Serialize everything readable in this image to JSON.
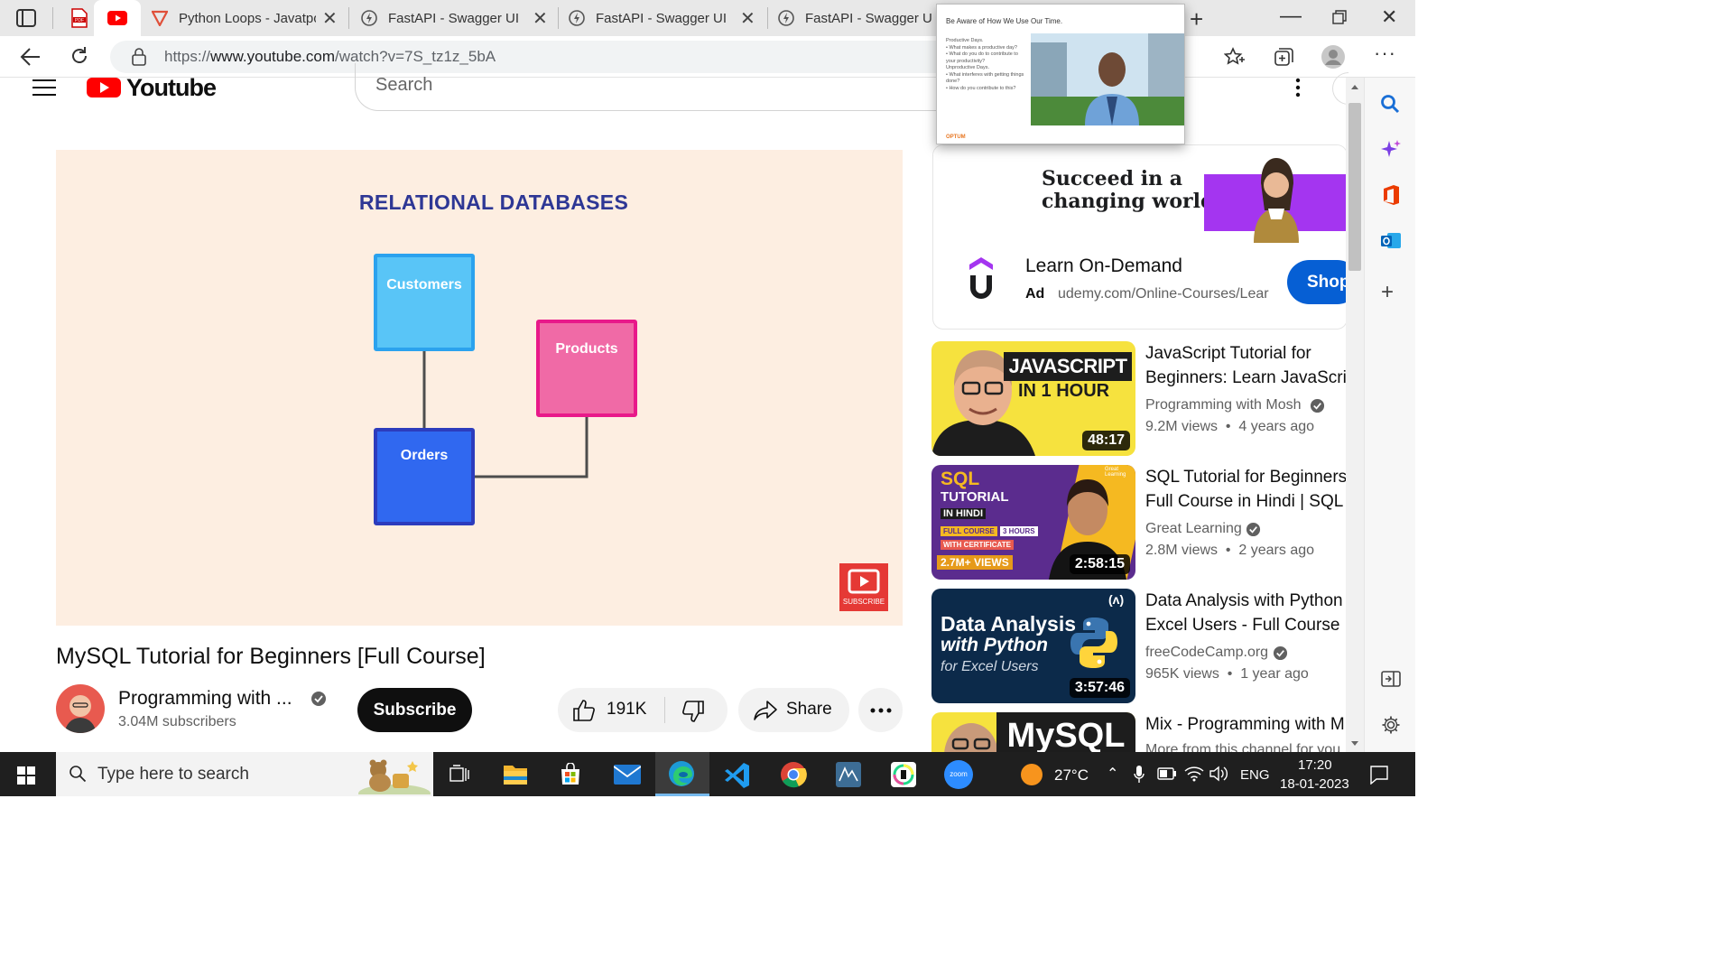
{
  "browser": {
    "tabs": [
      {
        "label": "",
        "icon": "pdf-icon"
      },
      {
        "label": "",
        "icon": "youtube-icon"
      },
      {
        "label": "Python Loops - Javatpo",
        "icon": "javatpoint-icon"
      },
      {
        "label": "FastAPI - Swagger UI",
        "icon": "fastapi-icon"
      },
      {
        "label": "FastAPI - Swagger UI",
        "icon": "fastapi-icon"
      },
      {
        "label": "FastAPI - Swagger UI",
        "icon": "fastapi-icon"
      }
    ],
    "url_prefix": "https://",
    "url_host": "www.youtube.com",
    "url_path": "/watch?v=7S_tz1z_5bA"
  },
  "tab_preview": {
    "heading": "Be Aware of How We Use Our Time.",
    "lines": [
      "Productive Days.",
      "• What makes a productive day?",
      "• What do you do to contribute to your productivity?",
      "Unproductive Days.",
      "• What interferes with getting things done?",
      "• How do you contribute to this?"
    ],
    "footer_logo": "OPTUM"
  },
  "youtube": {
    "logo_text": "Youtube",
    "search_placeholder": "Search"
  },
  "video": {
    "frame_heading": "RELATIONAL DATABASES",
    "boxes": {
      "customers": "Customers",
      "products": "Products",
      "orders": "Orders"
    },
    "subscribe_badge": "SUBSCRIBE",
    "title": "MySQL Tutorial for Beginners [Full Course]",
    "channel_name": "Programming with ...",
    "subscribers": "3.04M subscribers",
    "subscribe_label": "Subscribe",
    "likes": "191K",
    "share_label": "Share"
  },
  "ad": {
    "banner_text_1": "Succeed in a",
    "banner_text_2": "changing world",
    "title": "Learn On-Demand",
    "ad_label": "Ad",
    "domain": "udemy.com/Online-Courses/Lear",
    "cta": "Shop"
  },
  "recommendations": [
    {
      "title_1": "JavaScript Tutorial for",
      "title_2": "Beginners: Learn JavaScri",
      "channel": "Programming with Mosh",
      "meta": "9.2M views  •  4 years ago",
      "duration": "48:17",
      "thumb_line1": "JAVASCRIPT",
      "thumb_line2": "IN 1 HOUR"
    },
    {
      "title_1": "SQL Tutorial for Beginners",
      "title_2": "Full Course in Hindi | SQL f",
      "channel": "Great Learning",
      "meta": "2.8M views  •  2 years ago",
      "duration": "2:58:15",
      "thumb_line1": "SQL",
      "thumb_line2": "TUTORIAL",
      "thumb_line3": "IN HINDI",
      "thumb_tag1": "FULL COURSE",
      "thumb_tag2": "3 HOURS",
      "thumb_tag3": "WITH CERTIFICATE",
      "thumb_views": "2.7M+ VIEWS",
      "thumb_brand": "Great Learning"
    },
    {
      "title_1": "Data Analysis with Python",
      "title_2": "Excel Users - Full Course",
      "channel": "freeCodeCamp.org",
      "meta": "965K views  •  1 year ago",
      "duration": "3:57:46",
      "thumb_line1": "Data Analysis",
      "thumb_line2": "with Python",
      "thumb_line3": "for Excel Users",
      "thumb_brand": "(ʌ)"
    },
    {
      "title_1": "Mix - Programming with M",
      "channel": "More from this channel for you",
      "thumb_line1": "MySQL"
    }
  ],
  "taskbar": {
    "search_placeholder": "Type here to search",
    "zoom_label": "zoom",
    "temperature": "27°C",
    "language": "ENG",
    "time": "17:20",
    "date": "18-01-2023"
  },
  "colors": {
    "youtube_red": "#ff0000",
    "customers_box": "#59c5f7",
    "products_box": "#f06aa6",
    "orders_box": "#3068f0",
    "frame_title": "#2e3795",
    "player_bg": "#fdeee1",
    "udemy_purple": "#a435f0",
    "link_blue": "#065fd4"
  }
}
